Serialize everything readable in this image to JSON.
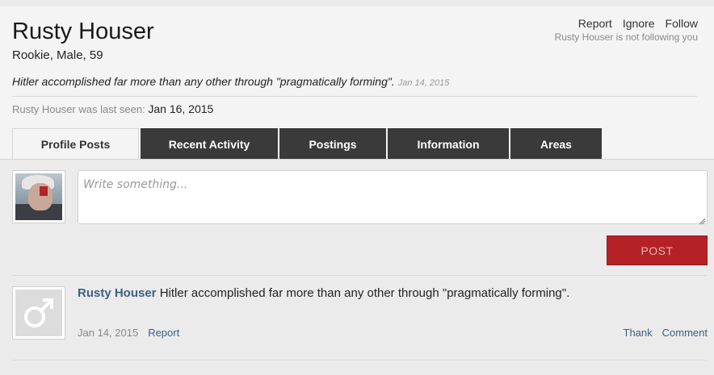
{
  "profile": {
    "username": "Rusty Houser",
    "blurb": "Rookie, Male, 59",
    "status_text": "Hitler accomplished far more than any other through \"pragmatically forming\".",
    "status_date": "Jan 14, 2015",
    "last_seen_label": "Rusty Houser was last seen:",
    "last_seen_value": "Jan 16, 2015",
    "follow_status": "Rusty Houser is not following you"
  },
  "actions": {
    "report": "Report",
    "ignore": "Ignore",
    "follow": "Follow"
  },
  "tabs": [
    {
      "label": "Profile Posts",
      "active": true
    },
    {
      "label": "Recent Activity",
      "active": false
    },
    {
      "label": "Postings",
      "active": false
    },
    {
      "label": "Information",
      "active": false
    },
    {
      "label": "Areas",
      "active": false
    }
  ],
  "compose": {
    "placeholder": "Write something...",
    "post_label": "POST"
  },
  "feed": [
    {
      "author": "Rusty Houser",
      "text": "Hitler accomplished far more than any other through \"pragmatically forming\".",
      "date": "Jan 14, 2015",
      "report_label": "Report",
      "thank_label": "Thank",
      "comment_label": "Comment"
    }
  ],
  "colors": {
    "accent_red": "#b42126",
    "link_blue": "#3b5f84",
    "tab_dark": "#3a3a3a"
  },
  "icons": {
    "post_avatar_icon": "male-symbol-icon"
  }
}
